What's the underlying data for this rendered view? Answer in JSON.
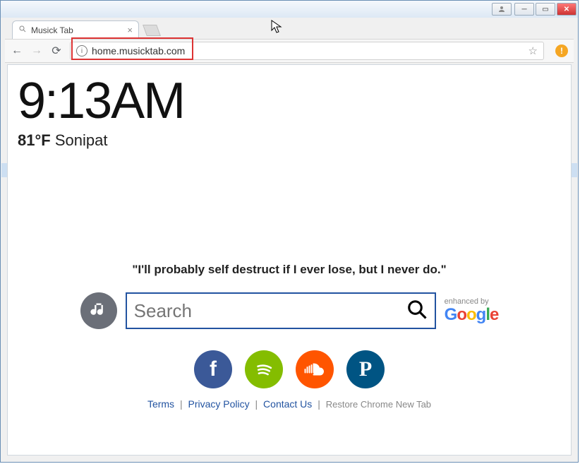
{
  "window": {
    "tab_title": "Musick Tab"
  },
  "toolbar": {
    "url": "home.musicktab.com"
  },
  "page": {
    "time": "9:13AM",
    "temperature": "81°F",
    "location": "Sonipat",
    "quote": "\"I'll probably self destruct if I ever lose, but I never do.\"",
    "search_placeholder": "Search",
    "enhanced_label": "enhanced by",
    "social": {
      "facebook": "f",
      "spotify": "",
      "soundcloud": "",
      "pandora": "P"
    },
    "footer": {
      "terms": "Terms",
      "privacy": "Privacy Policy",
      "contact": "Contact Us",
      "restore": "Restore Chrome New Tab"
    }
  }
}
